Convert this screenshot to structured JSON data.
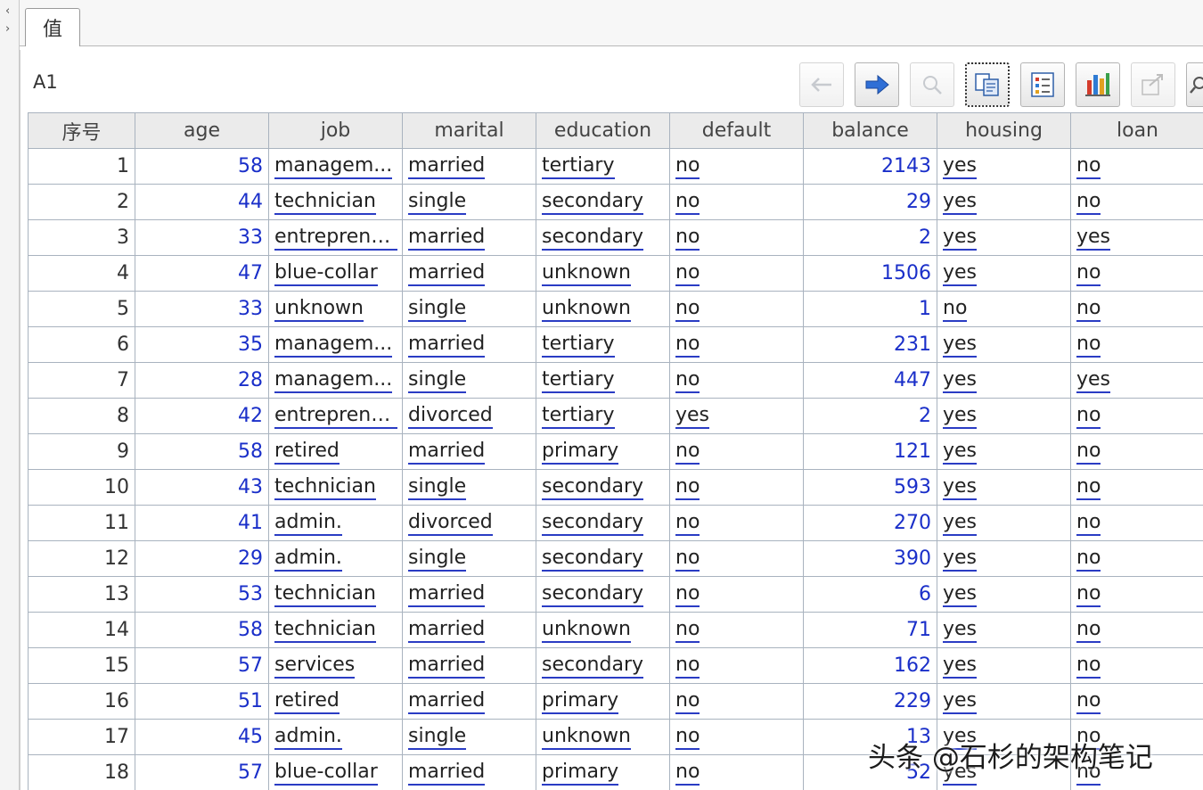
{
  "tab": {
    "label": "值"
  },
  "cell_ref": "A1",
  "toolbar": {
    "buttons": [
      {
        "icon": "back-arrow-icon",
        "enabled": false
      },
      {
        "icon": "forward-arrow-icon",
        "enabled": true
      },
      {
        "icon": "magnifier-icon",
        "enabled": false
      },
      {
        "icon": "copy-icon",
        "enabled": true
      },
      {
        "icon": "list-icon",
        "enabled": true
      },
      {
        "icon": "bar-chart-icon",
        "enabled": true
      },
      {
        "icon": "export-icon",
        "enabled": false
      },
      {
        "icon": "search-icon",
        "enabled": true
      }
    ]
  },
  "table": {
    "headers": [
      "序号",
      "age",
      "job",
      "marital",
      "education",
      "default",
      "balance",
      "housing",
      "loan"
    ],
    "rows": [
      [
        "1",
        "58",
        "managem...",
        "married",
        "tertiary",
        "no",
        "2143",
        "yes",
        "no"
      ],
      [
        "2",
        "44",
        "technician",
        "single",
        "secondary",
        "no",
        "29",
        "yes",
        "no"
      ],
      [
        "3",
        "33",
        "entrepreneur",
        "married",
        "secondary",
        "no",
        "2",
        "yes",
        "yes"
      ],
      [
        "4",
        "47",
        "blue-collar",
        "married",
        "unknown",
        "no",
        "1506",
        "yes",
        "no"
      ],
      [
        "5",
        "33",
        "unknown",
        "single",
        "unknown",
        "no",
        "1",
        "no",
        "no"
      ],
      [
        "6",
        "35",
        "managem...",
        "married",
        "tertiary",
        "no",
        "231",
        "yes",
        "no"
      ],
      [
        "7",
        "28",
        "managem...",
        "single",
        "tertiary",
        "no",
        "447",
        "yes",
        "yes"
      ],
      [
        "8",
        "42",
        "entrepreneur",
        "divorced",
        "tertiary",
        "yes",
        "2",
        "yes",
        "no"
      ],
      [
        "9",
        "58",
        "retired",
        "married",
        "primary",
        "no",
        "121",
        "yes",
        "no"
      ],
      [
        "10",
        "43",
        "technician",
        "single",
        "secondary",
        "no",
        "593",
        "yes",
        "no"
      ],
      [
        "11",
        "41",
        "admin.",
        "divorced",
        "secondary",
        "no",
        "270",
        "yes",
        "no"
      ],
      [
        "12",
        "29",
        "admin.",
        "single",
        "secondary",
        "no",
        "390",
        "yes",
        "no"
      ],
      [
        "13",
        "53",
        "technician",
        "married",
        "secondary",
        "no",
        "6",
        "yes",
        "no"
      ],
      [
        "14",
        "58",
        "technician",
        "married",
        "unknown",
        "no",
        "71",
        "yes",
        "no"
      ],
      [
        "15",
        "57",
        "services",
        "married",
        "secondary",
        "no",
        "162",
        "yes",
        "no"
      ],
      [
        "16",
        "51",
        "retired",
        "married",
        "primary",
        "no",
        "229",
        "yes",
        "no"
      ],
      [
        "17",
        "45",
        "admin.",
        "single",
        "unknown",
        "no",
        "13",
        "yes",
        "no"
      ],
      [
        "18",
        "57",
        "blue-collar",
        "married",
        "primary",
        "no",
        "52",
        "yes",
        "no"
      ]
    ]
  },
  "watermark": "头条 @石杉的架构笔记",
  "colors": {
    "link_underline": "#2a3cc4",
    "number": "#1a2fc9",
    "grid_line": "#a9b3bf"
  }
}
